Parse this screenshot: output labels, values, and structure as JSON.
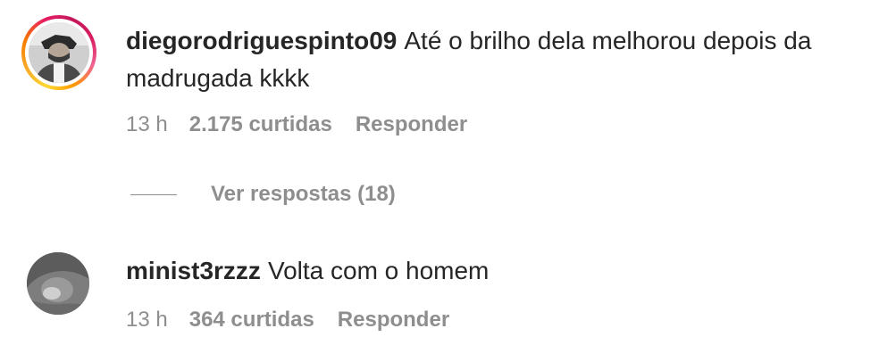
{
  "comments": [
    {
      "username": "diegorodriguespinto09",
      "text_line1": "Até o brilho dela melhorou depois da",
      "text_line2": "madrugada kkkk",
      "time": "13 h",
      "likes": "2.175 curtidas",
      "reply_label": "Responder",
      "has_story_ring": true,
      "view_replies_label": "Ver respostas (18)"
    },
    {
      "username": "minist3rzzz",
      "text_line1": "Volta com o homem",
      "time": "13 h",
      "likes": "364 curtidas",
      "reply_label": "Responder",
      "has_story_ring": false
    }
  ],
  "colors": {
    "text": "#262626",
    "meta": "#8e8e8e",
    "background": "#ffffff"
  }
}
